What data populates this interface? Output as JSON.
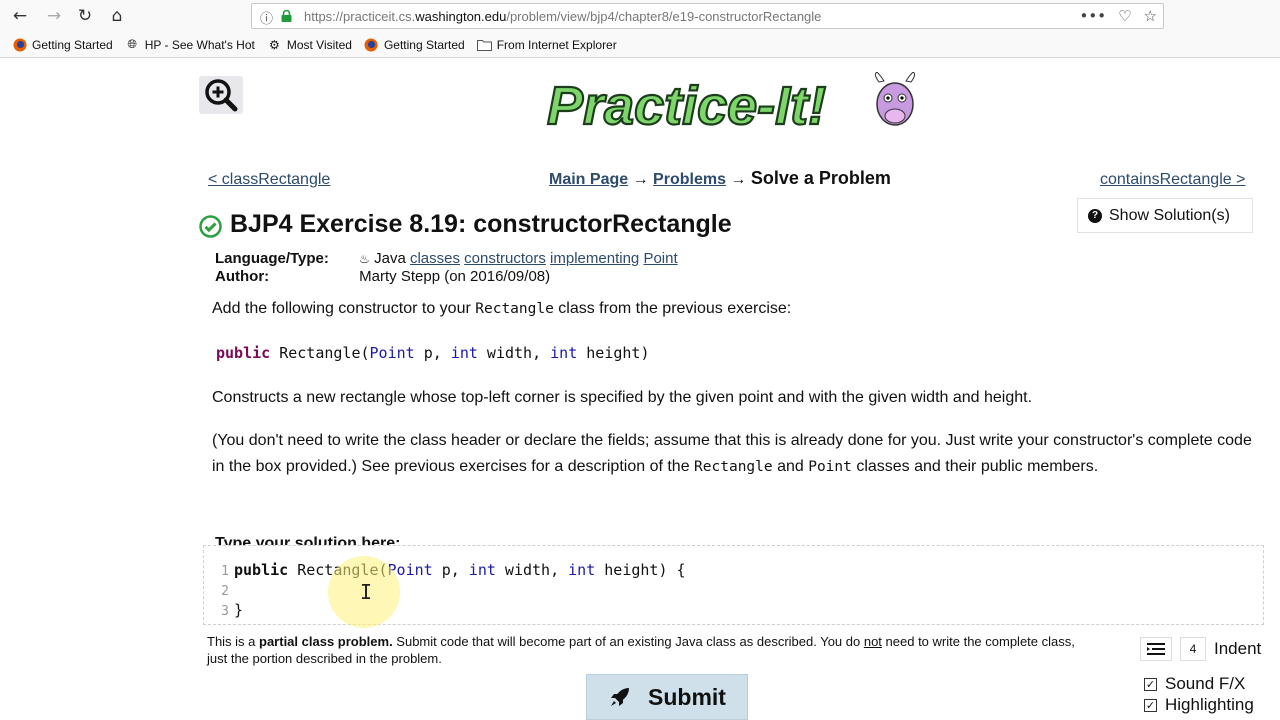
{
  "browser": {
    "url_prefix": "https://practiceit.cs.",
    "url_domain": "washington.edu",
    "url_path": "/problem/view/bjp4/chapter8/e19-constructorRectangle",
    "bookmarks": [
      {
        "label": "Getting Started",
        "icon": "firefox-icon"
      },
      {
        "label": "HP - See What's Hot",
        "icon": "globe-icon"
      },
      {
        "label": "Most Visited",
        "icon": "gear-icon"
      },
      {
        "label": "Getting Started",
        "icon": "firefox-icon"
      },
      {
        "label": "From Internet Explorer",
        "icon": "folder-icon"
      }
    ]
  },
  "logo": {
    "text": "Practice-It!"
  },
  "nav": {
    "prev": "< classRectangle",
    "next": "containsRectangle >",
    "breadcrumb": {
      "main": "Main Page",
      "sep": "→",
      "problems": "Problems",
      "current": "Solve a Problem"
    }
  },
  "show_solution": "Show Solution(s)",
  "problem": {
    "title": "BJP4 Exercise 8.19: constructorRectangle",
    "language_label": "Language/Type:",
    "language": "Java",
    "tags": [
      "classes",
      "constructors",
      "implementing",
      "Point"
    ],
    "author_label": "Author:",
    "author": "Marty Stepp (on 2016/09/08)",
    "intro_pre": "Add the following constructor to your ",
    "intro_code": "Rectangle",
    "intro_post": " class from the previous exercise:",
    "signature": {
      "kw": "public",
      "name": "Rectangle(",
      "t1": "Point",
      "a1": " p, ",
      "t2": "int",
      "a2": " width, ",
      "t3": "int",
      "a3": " height)"
    },
    "desc": "Constructs a new rectangle whose top-left corner is specified by the given point and with the given width and height.",
    "note_a": "(You don't need to write the class header or declare the fields; assume that this is already done for you. Just write your constructor's complete code in the box provided.) See previous exercises for a description of the ",
    "note_code1": "Rectangle",
    "note_and": " and ",
    "note_code2": "Point",
    "note_b": " classes and their public members."
  },
  "editor": {
    "label": "Type your solution here:",
    "lines": [
      {
        "num": "1",
        "kw": "public",
        "name": " Rectangle(",
        "t1": "Point",
        "a1": " p, ",
        "t2": "int",
        "a2": " width, ",
        "t3": "int",
        "a3": " height) {"
      },
      {
        "num": "2",
        "text": ""
      },
      {
        "num": "3",
        "text": "}"
      }
    ]
  },
  "footer_note": {
    "pre": "This is a ",
    "bold": "partial class problem.",
    "mid": " Submit code that will become part of an existing Java class as described. You do ",
    "under": "not",
    "post": " need to write the complete class, just the portion described in the problem."
  },
  "tools": {
    "indent_value": "4",
    "indent_label": "Indent"
  },
  "options": [
    {
      "label": "Sound F/X",
      "checked": true
    },
    {
      "label": "Highlighting",
      "checked": true
    }
  ],
  "submit": "Submit",
  "colors": {
    "link": "#2d4b6a",
    "keyword": "#7a0a55",
    "type": "#1a1aa6",
    "submit_bg": "#cfe0ea",
    "check_green": "#2ea043"
  }
}
